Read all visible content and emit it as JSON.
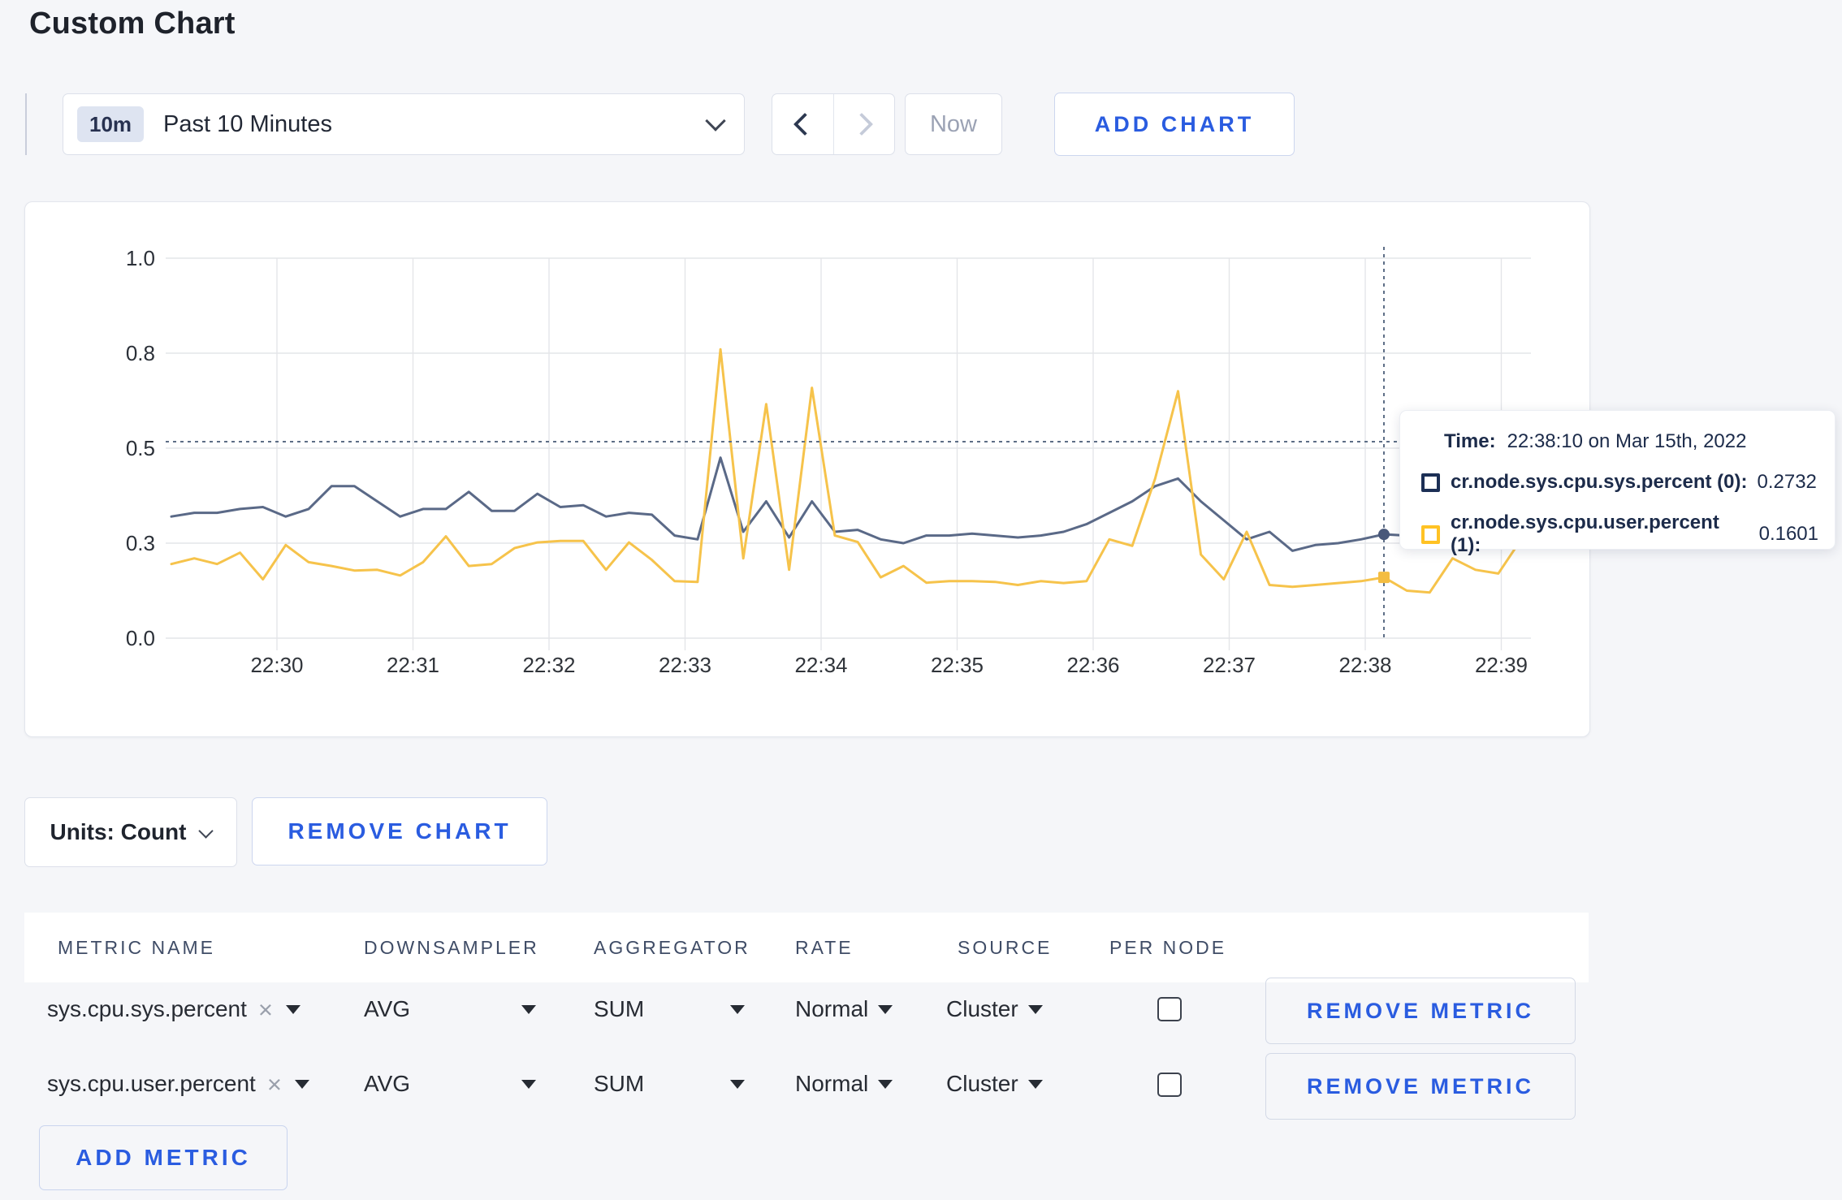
{
  "page": {
    "title": "Custom Chart"
  },
  "toolbar": {
    "time_window_badge": "10m",
    "time_window_label": "Past 10 Minutes",
    "now_label": "Now",
    "add_chart_label": "ADD CHART"
  },
  "chart_data": {
    "type": "line",
    "title": "",
    "xlabel": "",
    "ylabel": "",
    "ylim": [
      0,
      1.0
    ],
    "grid": true,
    "x_tick_labels": [
      "22:30",
      "22:31",
      "22:32",
      "22:33",
      "22:34",
      "22:35",
      "22:36",
      "22:37",
      "22:38",
      "22:39"
    ],
    "y_tick_labels": [
      "0.0",
      "0.3",
      "0.5",
      "0.8",
      "1.0"
    ],
    "y_tick_values": [
      0,
      0.25,
      0.5,
      0.75,
      1.0
    ],
    "x_start_time": "22:29:20",
    "x_end_time": "22:39:10",
    "interval_seconds": 10,
    "series": [
      {
        "name": "cr.node.sys.cpu.sys.percent",
        "color": "#5a6987",
        "marker_color": "#49587a",
        "values": [
          0.32,
          0.33,
          0.33,
          0.34,
          0.345,
          0.32,
          0.34,
          0.4,
          0.4,
          0.36,
          0.32,
          0.34,
          0.34,
          0.385,
          0.335,
          0.335,
          0.38,
          0.345,
          0.35,
          0.32,
          0.33,
          0.325,
          0.27,
          0.26,
          0.475,
          0.28,
          0.36,
          0.265,
          0.36,
          0.28,
          0.285,
          0.26,
          0.25,
          0.27,
          0.27,
          0.275,
          0.27,
          0.265,
          0.27,
          0.28,
          0.3,
          0.33,
          0.36,
          0.4,
          0.42,
          0.36,
          0.31,
          0.26,
          0.28,
          0.23,
          0.245,
          0.25,
          0.26,
          0.2732,
          0.27,
          0.28,
          0.3,
          0.31,
          0.3,
          0.3
        ]
      },
      {
        "name": "cr.node.sys.cpu.user.percent",
        "color": "#f6c34b",
        "marker_color": "#f4bd41",
        "values": [
          0.195,
          0.21,
          0.195,
          0.225,
          0.155,
          0.245,
          0.2,
          0.19,
          0.178,
          0.18,
          0.165,
          0.2,
          0.268,
          0.19,
          0.195,
          0.237,
          0.252,
          0.256,
          0.256,
          0.18,
          0.252,
          0.206,
          0.15,
          0.148,
          0.76,
          0.21,
          0.616,
          0.18,
          0.659,
          0.27,
          0.253,
          0.16,
          0.19,
          0.146,
          0.15,
          0.15,
          0.148,
          0.14,
          0.15,
          0.145,
          0.15,
          0.26,
          0.243,
          0.42,
          0.65,
          0.22,
          0.155,
          0.28,
          0.14,
          0.135,
          0.14,
          0.145,
          0.15,
          0.1601,
          0.125,
          0.12,
          0.21,
          0.18,
          0.17,
          0.26
        ]
      }
    ],
    "crosshair": {
      "index": 53,
      "time": "22:38:10",
      "hline_value": 0.517
    },
    "colors": {
      "grid": "#e4e5e9",
      "crosshair": "#5d6e86",
      "tick_text": "#2b3038"
    },
    "legend_position": "tooltip"
  },
  "tooltip": {
    "time_label": "Time:",
    "time_value": "22:38:10 on Mar 15th, 2022",
    "rows": [
      {
        "label": "cr.node.sys.cpu.sys.percent (0):",
        "value": "0.2732",
        "color": "#1c2f55"
      },
      {
        "label": "cr.node.sys.cpu.user.percent (1):",
        "value": "0.1601",
        "color": "#ffc224"
      }
    ]
  },
  "chart_controls": {
    "units_label": "Units: Count",
    "remove_chart_label": "REMOVE CHART"
  },
  "metrics_table": {
    "headers": [
      "METRIC NAME",
      "DOWNSAMPLER",
      "AGGREGATOR",
      "RATE",
      "SOURCE",
      "PER NODE"
    ],
    "rows": [
      {
        "metric": "sys.cpu.sys.percent",
        "downsampler": "AVG",
        "aggregator": "SUM",
        "rate": "Normal",
        "source": "Cluster",
        "per_node_checked": false,
        "remove_label": "REMOVE METRIC"
      },
      {
        "metric": "sys.cpu.user.percent",
        "downsampler": "AVG",
        "aggregator": "SUM",
        "rate": "Normal",
        "source": "Cluster",
        "per_node_checked": false,
        "remove_label": "REMOVE METRIC"
      }
    ],
    "add_metric_label": "ADD METRIC",
    "accent_color": "#2a5ce0"
  }
}
